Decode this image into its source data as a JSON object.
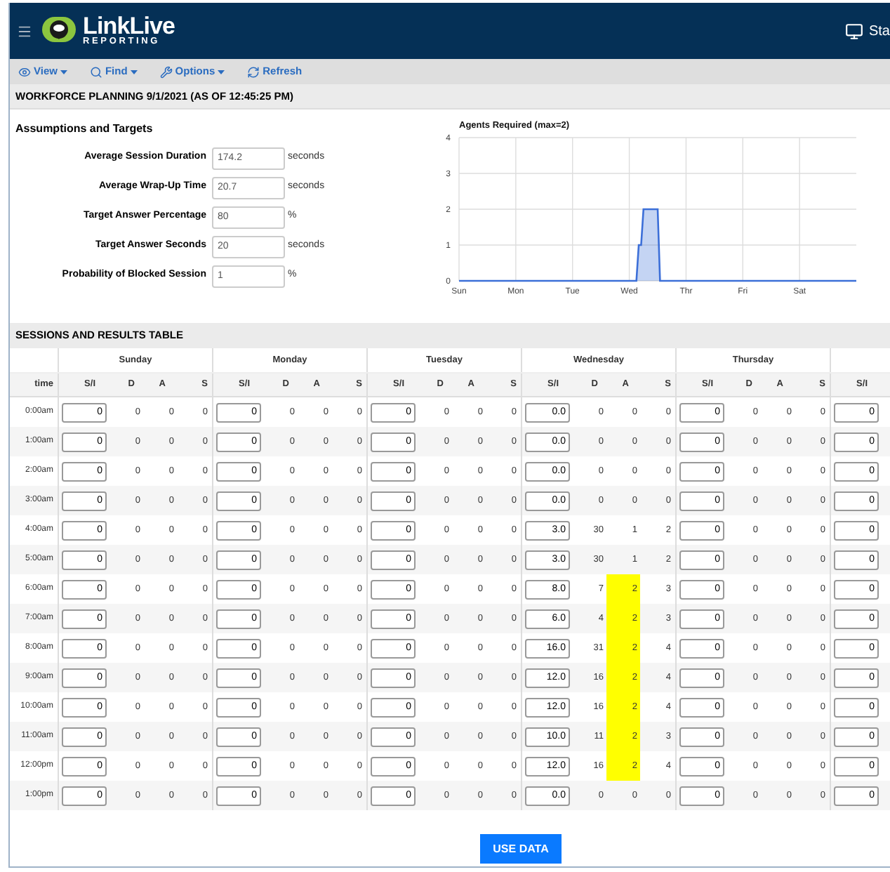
{
  "header": {
    "brand": "LinkLive",
    "brand_sub": "REPORTING",
    "right_label": "Sta"
  },
  "toolbar": [
    {
      "label": "View",
      "kind": "view",
      "dropdown": true
    },
    {
      "label": "Find",
      "kind": "find",
      "dropdown": true
    },
    {
      "label": "Options",
      "kind": "options",
      "dropdown": true
    },
    {
      "label": "Refresh",
      "kind": "refresh",
      "dropdown": false
    }
  ],
  "page_title": "WORKFORCE PLANNING 9/1/2021 (AS OF 12:45:25 PM)",
  "assumptions": {
    "title": "Assumptions and Targets",
    "fields": [
      {
        "label": "Average Session Duration",
        "value": "174.2",
        "unit": "seconds"
      },
      {
        "label": "Average Wrap-Up Time",
        "value": "20.7",
        "unit": "seconds"
      },
      {
        "label": "Target Answer Percentage",
        "value": "80",
        "unit": "%"
      },
      {
        "label": "Target Answer Seconds",
        "value": "20",
        "unit": "seconds"
      },
      {
        "label": "Probability of Blocked Session",
        "value": "1",
        "unit": "%"
      }
    ]
  },
  "chart_data": {
    "type": "area",
    "title": "Agents Required (max=2)",
    "grid": true,
    "ylim": [
      0,
      4
    ],
    "yticks": [
      0,
      1,
      2,
      3,
      4
    ],
    "categories": [
      "Sun",
      null,
      null,
      null,
      null,
      null,
      null,
      null,
      null,
      null,
      null,
      null,
      null,
      null,
      null,
      null,
      null,
      null,
      null,
      null,
      null,
      null,
      null,
      null,
      "Mon",
      null,
      null,
      null,
      null,
      null,
      null,
      null,
      null,
      null,
      null,
      null,
      null,
      null,
      null,
      null,
      null,
      null,
      null,
      null,
      null,
      null,
      null,
      null,
      "Tue",
      null,
      null,
      null,
      null,
      null,
      null,
      null,
      null,
      null,
      null,
      null,
      null,
      null,
      null,
      null,
      null,
      null,
      null,
      null,
      null,
      null,
      null,
      null,
      "Wed",
      null,
      null,
      null,
      null,
      null,
      null,
      null,
      null,
      null,
      null,
      null,
      null,
      null,
      null,
      null,
      null,
      null,
      null,
      null,
      null,
      null,
      null,
      null,
      "Thr",
      null,
      null,
      null,
      null,
      null,
      null,
      null,
      null,
      null,
      null,
      null,
      null,
      null,
      null,
      null,
      null,
      null,
      null,
      null,
      null,
      null,
      null,
      null,
      "Fri",
      null,
      null,
      null,
      null,
      null,
      null,
      null,
      null,
      null,
      null,
      null,
      null,
      null,
      null,
      null,
      null,
      null,
      null,
      null,
      null,
      null,
      null,
      null,
      "Sat",
      null,
      null,
      null,
      null,
      null,
      null,
      null,
      null,
      null,
      null,
      null,
      null,
      null,
      null,
      null,
      null,
      null,
      null,
      null,
      null,
      null,
      null,
      null
    ],
    "series": [
      {
        "color": "#3c6fd8",
        "values": [
          0,
          0,
          0,
          0,
          0,
          0,
          0,
          0,
          0,
          0,
          0,
          0,
          0,
          0,
          0,
          0,
          0,
          0,
          0,
          0,
          0,
          0,
          0,
          0,
          0,
          0,
          0,
          0,
          0,
          0,
          0,
          0,
          0,
          0,
          0,
          0,
          0,
          0,
          0,
          0,
          0,
          0,
          0,
          0,
          0,
          0,
          0,
          0,
          0,
          0,
          0,
          0,
          0,
          0,
          0,
          0,
          0,
          0,
          0,
          0,
          0,
          0,
          0,
          0,
          0,
          0,
          0,
          0,
          0,
          0,
          0,
          0,
          0,
          0,
          0,
          0,
          1,
          1,
          2,
          2,
          2,
          2,
          2,
          2,
          2,
          0,
          0,
          0,
          0,
          0,
          0,
          0,
          0,
          0,
          0,
          0,
          0,
          0,
          0,
          0,
          0,
          0,
          0,
          0,
          0,
          0,
          0,
          0,
          0,
          0,
          0,
          0,
          0,
          0,
          0,
          0,
          0,
          0,
          0,
          0,
          0,
          0,
          0,
          0,
          0,
          0,
          0,
          0,
          0,
          0,
          0,
          0,
          0,
          0,
          0,
          0,
          0,
          0,
          0,
          0,
          0,
          0,
          0,
          0,
          0,
          0,
          0,
          0,
          0,
          0,
          0,
          0,
          0,
          0,
          0,
          0,
          0,
          0,
          0,
          0,
          0,
          0,
          0,
          0,
          0,
          0,
          0,
          0
        ]
      }
    ]
  },
  "table": {
    "title": "SESSIONS AND RESULTS TABLE",
    "time_header": "time",
    "days": [
      {
        "name": "Sunday",
        "sub_headers": [
          "S/I",
          "D",
          "A",
          "S"
        ]
      },
      {
        "name": "Monday",
        "sub_headers": [
          "S/I",
          "D",
          "A",
          "S"
        ]
      },
      {
        "name": "Tuesday",
        "sub_headers": [
          "S/I",
          "D",
          "A",
          "S"
        ]
      },
      {
        "name": "Wednesday",
        "sub_headers": [
          "S/I",
          "D",
          "A",
          "S"
        ]
      },
      {
        "name": "Thursday",
        "sub_headers": [
          "S/I",
          "D",
          "A",
          "S"
        ]
      }
    ],
    "last_column_header": "S/I",
    "rows": [
      {
        "time": "0:00am",
        "cells": [
          [
            "0",
            "0",
            "0",
            "0",
            false
          ],
          [
            "0",
            "0",
            "0",
            "0",
            false
          ],
          [
            "0",
            "0",
            "0",
            "0",
            false
          ],
          [
            "0.0",
            "0",
            "0",
            "0",
            false
          ],
          [
            "0",
            "0",
            "0",
            "0",
            false
          ]
        ],
        "last_si": "0"
      },
      {
        "time": "1:00am",
        "cells": [
          [
            "0",
            "0",
            "0",
            "0",
            false
          ],
          [
            "0",
            "0",
            "0",
            "0",
            false
          ],
          [
            "0",
            "0",
            "0",
            "0",
            false
          ],
          [
            "0.0",
            "0",
            "0",
            "0",
            false
          ],
          [
            "0",
            "0",
            "0",
            "0",
            false
          ]
        ],
        "last_si": "0"
      },
      {
        "time": "2:00am",
        "cells": [
          [
            "0",
            "0",
            "0",
            "0",
            false
          ],
          [
            "0",
            "0",
            "0",
            "0",
            false
          ],
          [
            "0",
            "0",
            "0",
            "0",
            false
          ],
          [
            "0.0",
            "0",
            "0",
            "0",
            false
          ],
          [
            "0",
            "0",
            "0",
            "0",
            false
          ]
        ],
        "last_si": "0"
      },
      {
        "time": "3:00am",
        "cells": [
          [
            "0",
            "0",
            "0",
            "0",
            false
          ],
          [
            "0",
            "0",
            "0",
            "0",
            false
          ],
          [
            "0",
            "0",
            "0",
            "0",
            false
          ],
          [
            "0.0",
            "0",
            "0",
            "0",
            false
          ],
          [
            "0",
            "0",
            "0",
            "0",
            false
          ]
        ],
        "last_si": "0"
      },
      {
        "time": "4:00am",
        "cells": [
          [
            "0",
            "0",
            "0",
            "0",
            false
          ],
          [
            "0",
            "0",
            "0",
            "0",
            false
          ],
          [
            "0",
            "0",
            "0",
            "0",
            false
          ],
          [
            "3.0",
            "30",
            "1",
            "2",
            false
          ],
          [
            "0",
            "0",
            "0",
            "0",
            false
          ]
        ],
        "last_si": "0"
      },
      {
        "time": "5:00am",
        "cells": [
          [
            "0",
            "0",
            "0",
            "0",
            false
          ],
          [
            "0",
            "0",
            "0",
            "0",
            false
          ],
          [
            "0",
            "0",
            "0",
            "0",
            false
          ],
          [
            "3.0",
            "30",
            "1",
            "2",
            false
          ],
          [
            "0",
            "0",
            "0",
            "0",
            false
          ]
        ],
        "last_si": "0"
      },
      {
        "time": "6:00am",
        "cells": [
          [
            "0",
            "0",
            "0",
            "0",
            false
          ],
          [
            "0",
            "0",
            "0",
            "0",
            false
          ],
          [
            "0",
            "0",
            "0",
            "0",
            false
          ],
          [
            "8.0",
            "7",
            "2",
            "3",
            true
          ],
          [
            "0",
            "0",
            "0",
            "0",
            false
          ]
        ],
        "last_si": "0"
      },
      {
        "time": "7:00am",
        "cells": [
          [
            "0",
            "0",
            "0",
            "0",
            false
          ],
          [
            "0",
            "0",
            "0",
            "0",
            false
          ],
          [
            "0",
            "0",
            "0",
            "0",
            false
          ],
          [
            "6.0",
            "4",
            "2",
            "3",
            true
          ],
          [
            "0",
            "0",
            "0",
            "0",
            false
          ]
        ],
        "last_si": "0"
      },
      {
        "time": "8:00am",
        "cells": [
          [
            "0",
            "0",
            "0",
            "0",
            false
          ],
          [
            "0",
            "0",
            "0",
            "0",
            false
          ],
          [
            "0",
            "0",
            "0",
            "0",
            false
          ],
          [
            "16.0",
            "31",
            "2",
            "4",
            true
          ],
          [
            "0",
            "0",
            "0",
            "0",
            false
          ]
        ],
        "last_si": "0"
      },
      {
        "time": "9:00am",
        "cells": [
          [
            "0",
            "0",
            "0",
            "0",
            false
          ],
          [
            "0",
            "0",
            "0",
            "0",
            false
          ],
          [
            "0",
            "0",
            "0",
            "0",
            false
          ],
          [
            "12.0",
            "16",
            "2",
            "4",
            true
          ],
          [
            "0",
            "0",
            "0",
            "0",
            false
          ]
        ],
        "last_si": "0"
      },
      {
        "time": "10:00am",
        "cells": [
          [
            "0",
            "0",
            "0",
            "0",
            false
          ],
          [
            "0",
            "0",
            "0",
            "0",
            false
          ],
          [
            "0",
            "0",
            "0",
            "0",
            false
          ],
          [
            "12.0",
            "16",
            "2",
            "4",
            true
          ],
          [
            "0",
            "0",
            "0",
            "0",
            false
          ]
        ],
        "last_si": "0"
      },
      {
        "time": "11:00am",
        "cells": [
          [
            "0",
            "0",
            "0",
            "0",
            false
          ],
          [
            "0",
            "0",
            "0",
            "0",
            false
          ],
          [
            "0",
            "0",
            "0",
            "0",
            false
          ],
          [
            "10.0",
            "11",
            "2",
            "3",
            true
          ],
          [
            "0",
            "0",
            "0",
            "0",
            false
          ]
        ],
        "last_si": "0"
      },
      {
        "time": "12:00pm",
        "cells": [
          [
            "0",
            "0",
            "0",
            "0",
            false
          ],
          [
            "0",
            "0",
            "0",
            "0",
            false
          ],
          [
            "0",
            "0",
            "0",
            "0",
            false
          ],
          [
            "12.0",
            "16",
            "2",
            "4",
            true
          ],
          [
            "0",
            "0",
            "0",
            "0",
            false
          ]
        ],
        "last_si": "0"
      },
      {
        "time": "1:00pm",
        "cells": [
          [
            "0",
            "0",
            "0",
            "0",
            false
          ],
          [
            "0",
            "0",
            "0",
            "0",
            false
          ],
          [
            "0",
            "0",
            "0",
            "0",
            false
          ],
          [
            "0.0",
            "0",
            "0",
            "0",
            false
          ],
          [
            "0",
            "0",
            "0",
            "0",
            false
          ]
        ],
        "last_si": "0"
      }
    ]
  },
  "primary_button": "USE DATA"
}
